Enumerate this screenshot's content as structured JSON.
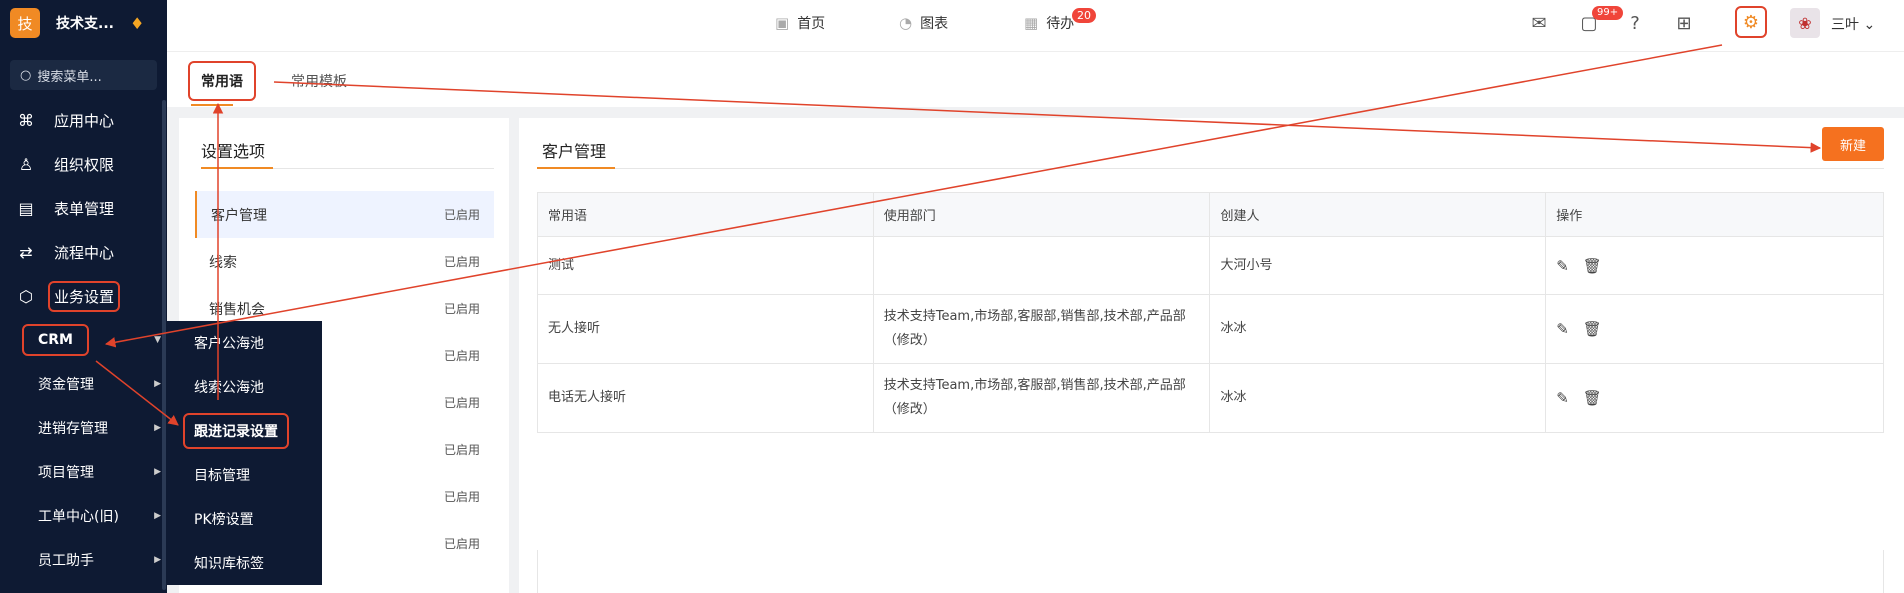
{
  "brand": {
    "logo_char": "技",
    "name": "技术支...",
    "badge_icon": "diamond-icon"
  },
  "sidebar": {
    "search_placeholder": "搜索菜单...",
    "items": [
      {
        "label": "应用中心",
        "icon": "app-center-icon"
      },
      {
        "label": "组织权限",
        "icon": "user-icon"
      },
      {
        "label": "表单管理",
        "icon": "form-icon"
      },
      {
        "label": "流程中心",
        "icon": "flow-icon"
      },
      {
        "label": "业务设置",
        "icon": "cube-icon"
      }
    ],
    "sub_items": [
      "CRM",
      "资金管理",
      "进销存管理",
      "项目管理",
      "工单中心(旧)",
      "员工助手"
    ]
  },
  "flyout": {
    "items": [
      "客户公海池",
      "线索公海池",
      "跟进记录设置",
      "目标管理",
      "PK榜设置",
      "知识库标签"
    ]
  },
  "topbar": {
    "home_label": "首页",
    "charts_label": "图表",
    "todo_label": "待办",
    "todo_badge": "20",
    "chat_badge": "99+",
    "user_name": "三叶"
  },
  "tabs": {
    "common_label": "常用语",
    "template_label": "常用模板"
  },
  "left_panel": {
    "title": "设置选项",
    "options": [
      {
        "label": "客户管理",
        "status": "已启用"
      },
      {
        "label": "线索",
        "status": "已启用"
      },
      {
        "label": "销售机会",
        "status": "已启用"
      },
      {
        "label": "",
        "status": "已启用"
      },
      {
        "label": "",
        "status": "已启用"
      },
      {
        "label": "",
        "status": "已启用"
      },
      {
        "label": "",
        "status": "已启用"
      },
      {
        "label": "",
        "status": "已启用"
      }
    ]
  },
  "right_panel": {
    "title": "客户管理",
    "new_button": "新建",
    "columns": [
      "常用语",
      "使用部门",
      "创建人",
      "操作"
    ],
    "rows": [
      {
        "phrase": "测试",
        "dept": "",
        "dept_note": "",
        "creator": "大河小号"
      },
      {
        "phrase": "无人接听",
        "dept": "技术支持Team,市场部,客服部,销售部,技术部,产品部",
        "dept_note": "（修改）",
        "creator": "冰冰"
      },
      {
        "phrase": "电话无人接听",
        "dept": "技术支持Team,市场部,客服部,销售部,技术部,产品部",
        "dept_note": "（修改）",
        "creator": "冰冰"
      }
    ]
  },
  "colors": {
    "accent": "#f5711f",
    "annotation_red": "#e0432b",
    "sidebar_bg": "#0e1a33"
  }
}
